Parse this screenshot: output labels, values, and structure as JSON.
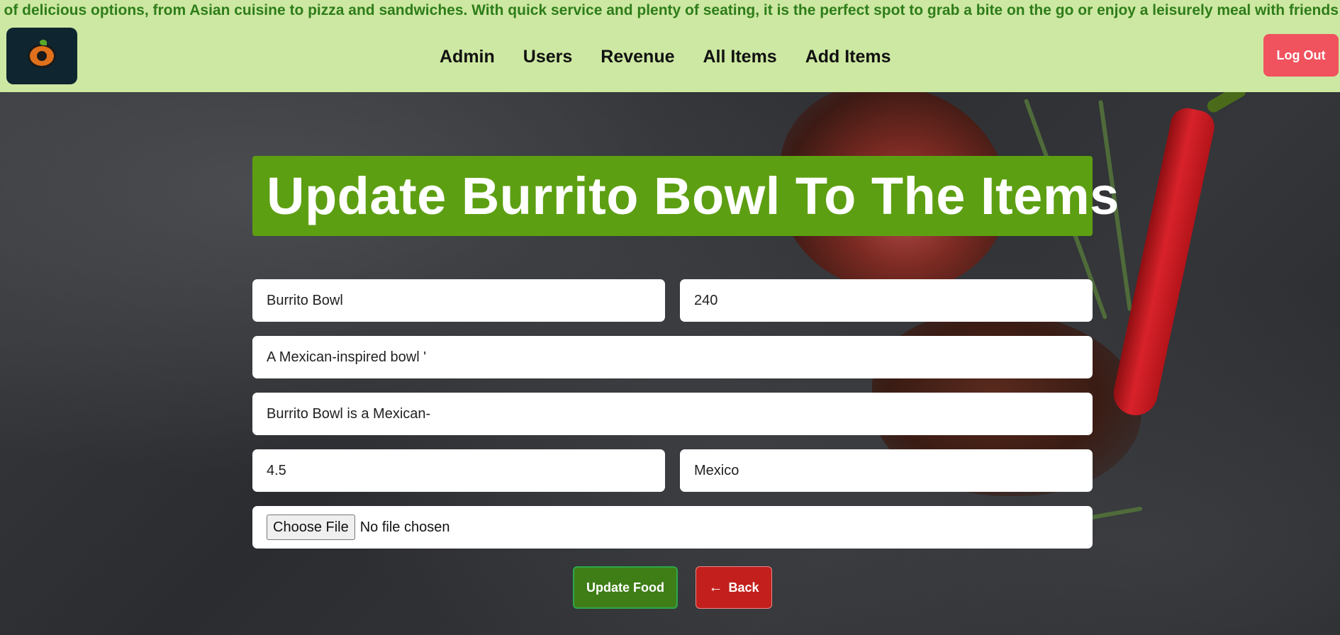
{
  "marquee": {
    "text": "y of delicious options, from Asian cuisine to pizza and sandwiches. With quick service and plenty of seating, it is the perfect spot to grab a bite on the go or enjoy a leisurely meal with friends and family. Come b"
  },
  "navbar": {
    "links": [
      {
        "label": "Admin"
      },
      {
        "label": "Users"
      },
      {
        "label": "Revenue"
      },
      {
        "label": "All Items"
      },
      {
        "label": "Add Items"
      }
    ],
    "logout_label": "Log Out"
  },
  "form": {
    "title": "Update Burrito Bowl To The Items",
    "name_value": "Burrito Bowl",
    "price_value": "240",
    "short_desc_value": "A Mexican-inspired bowl '",
    "long_desc_value": "Burrito Bowl is a Mexican-",
    "rating_value": "4.5",
    "origin_value": "Mexico",
    "file_button_label": "Choose File",
    "file_status": "No file chosen",
    "update_label": "Update Food",
    "back_label": "Back",
    "back_icon": "arrow-left-icon"
  },
  "colors": {
    "navbar_bg": "#cde8a2",
    "title_bg": "#5d9f12",
    "logout_bg": "#f0525e",
    "update_bg": "#3f7d17",
    "back_bg": "#c3201d"
  }
}
